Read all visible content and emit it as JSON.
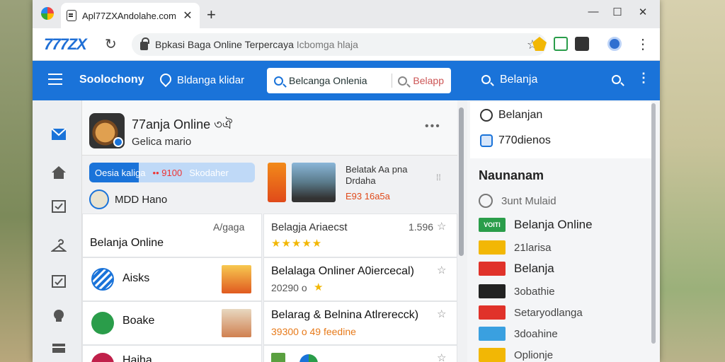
{
  "browser": {
    "tab_title": "Apl77ZXAndolahe.com",
    "tab_close": "✕",
    "new_tab": "+",
    "win_min": "—",
    "win_max": "☐",
    "win_close": "✕",
    "brand": "777ZX",
    "reload": "↻",
    "url_main": "Bpkasi Baga Online Terpercaya",
    "url_dim": "Icbomga hlaja",
    "star": "☆",
    "menu": "⋮"
  },
  "appbar": {
    "title": "Soolochony",
    "subtitle": "Bldanga klidar",
    "search_value": "Belcanga Onlenia",
    "search_button": "Belapp"
  },
  "right_panel": {
    "header_label": "Belanja",
    "more": "⋮",
    "card_items": [
      "Belanjan",
      "770dienos"
    ],
    "section_title": "Naunanam",
    "list": [
      {
        "label": "3unt Mulaid",
        "style": "gray",
        "icon_text": "",
        "color": "#777777"
      },
      {
        "label": "Belanja Online",
        "style": "large",
        "icon_text": "VOITI",
        "color": "#2a9d4a"
      },
      {
        "label": "21larisa",
        "style": "small",
        "icon_text": "",
        "color": "#f2b705"
      },
      {
        "label": "Belanja",
        "style": "large",
        "icon_text": "",
        "color": "#e0322a"
      },
      {
        "label": "3obathie",
        "style": "small",
        "icon_text": "",
        "color": "#222222"
      },
      {
        "label": "Setaryodlanga",
        "style": "small",
        "icon_text": "",
        "color": "#e0322a"
      },
      {
        "label": "3doahine",
        "style": "small",
        "icon_text": "",
        "color": "#3aa0e0"
      },
      {
        "label": "Oplionje",
        "style": "small",
        "icon_text": "",
        "color": "#f2b705"
      }
    ]
  },
  "main": {
    "post_title": "77anja Online ৩ঐ",
    "post_sub": "Gelica mario",
    "post_more": "•••",
    "promo_a": "Oesia kaliga",
    "promo_b": "•• 9100",
    "promo_c": "Skodaher",
    "store_label": "MDD Hano",
    "promo_card_title": "Belatak Aa pna Drdaha",
    "promo_card_price": "E93 16a5a",
    "cards_left": [
      {
        "title": "Belanja Online",
        "meta": "A/gaga",
        "icon_color": "",
        "thumb": ""
      },
      {
        "title": "Aisks",
        "meta": "",
        "icon_color": "#1a73d9",
        "thumb": "#f28a1a"
      },
      {
        "title": "Boake",
        "meta": "",
        "icon_color": "#2a9d4a",
        "thumb": "#e0b090"
      },
      {
        "title": "Haiha",
        "meta": "",
        "icon_color": "#c0204a",
        "thumb": "#f2b705"
      }
    ],
    "cards_right": [
      {
        "title": "Belagja Ariaecst",
        "meta": "1.596",
        "stars": "★★★★★",
        "price": ""
      },
      {
        "title": "Belalaga Onliner A0iercecal)",
        "meta": "",
        "stars": "★",
        "price": "20290 o"
      },
      {
        "title": "Belarag & Belnina Atlrerecck)",
        "meta": "",
        "stars": "",
        "price": "39300 o 49 feedine"
      },
      {
        "title": "",
        "meta": "",
        "stars": "",
        "price": ""
      }
    ],
    "star_outline": "☆"
  }
}
